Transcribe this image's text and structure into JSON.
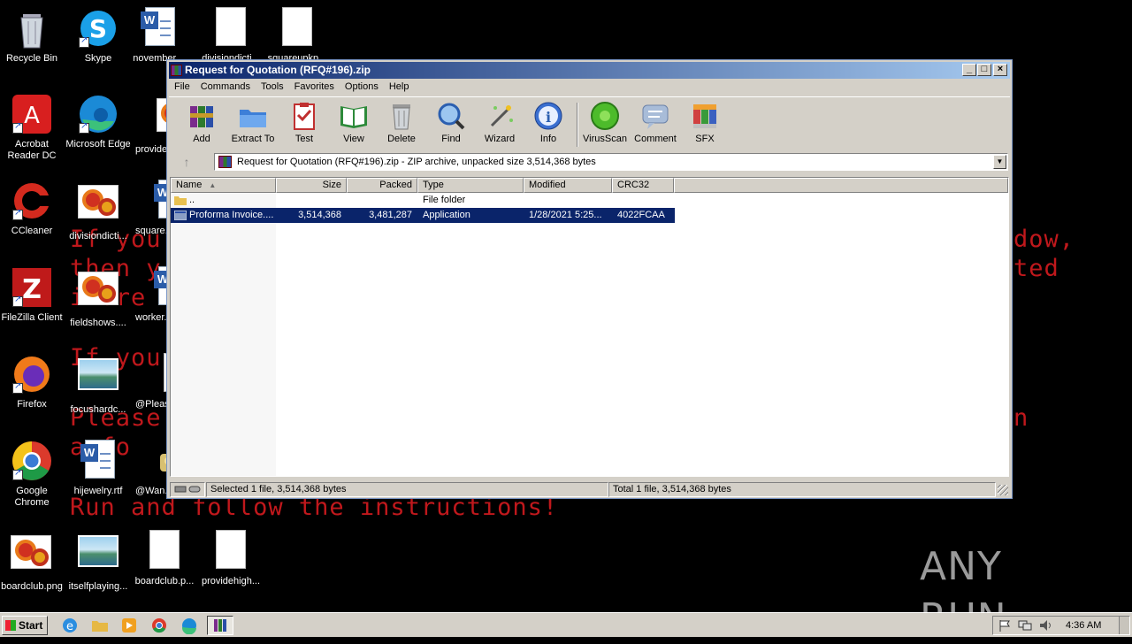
{
  "ransom_lines": [
    "If you",
    "then y",
    "i fre",
    "If you",
    "Please",
    "a fo",
    "Run and follow the instructions!",
    "dow,",
    "ted",
    "n"
  ],
  "desktop": {
    "icons": [
      {
        "label": "Recycle Bin"
      },
      {
        "label": "Skype"
      },
      {
        "label": "november..."
      },
      {
        "label": "divisiondicti..."
      },
      {
        "label": "squareupkp..."
      },
      {
        "label": "Acrobat Reader DC"
      },
      {
        "label": "Microsoft Edge"
      },
      {
        "label": "provide..."
      },
      {
        "label": "CCleaner"
      },
      {
        "label": "divisiondicti..."
      },
      {
        "label": "square..."
      },
      {
        "label": "FileZilla Client"
      },
      {
        "label": "fieldshows...."
      },
      {
        "label": "worker..."
      },
      {
        "label": "Firefox"
      },
      {
        "label": "focushardc..."
      },
      {
        "label": "@Pleas..."
      },
      {
        "label": "Google Chrome"
      },
      {
        "label": "hijewelry.rtf"
      },
      {
        "label": "@Wan..."
      },
      {
        "label": "boardclub.png"
      },
      {
        "label": "itselfplaying..."
      },
      {
        "label": "boardclub.p..."
      },
      {
        "label": "providehigh..."
      }
    ]
  },
  "window": {
    "title": "Request for Quotation (RFQ#196).zip",
    "menu": [
      "File",
      "Commands",
      "Tools",
      "Favorites",
      "Options",
      "Help"
    ],
    "toolbar": [
      "Add",
      "Extract To",
      "Test",
      "View",
      "Delete",
      "Find",
      "Wizard",
      "Info",
      "VirusScan",
      "Comment",
      "SFX"
    ],
    "address": "Request for Quotation (RFQ#196).zip - ZIP archive, unpacked size 3,514,368 bytes",
    "columns": [
      "Name",
      "Size",
      "Packed",
      "Type",
      "Modified",
      "CRC32"
    ],
    "rows": [
      {
        "name": "..",
        "size": "",
        "packed": "",
        "type": "File folder",
        "modified": "",
        "crc": ""
      },
      {
        "name": "Proforma Invoice....",
        "size": "3,514,368",
        "packed": "3,481,287",
        "type": "Application",
        "modified": "1/28/2021 5:25...",
        "crc": "4022FCAA"
      }
    ],
    "status_left": "Selected 1 file, 3,514,368 bytes",
    "status_right": "Total 1 file, 3,514,368 bytes"
  },
  "taskbar": {
    "start": "Start",
    "clock": "4:36 AM"
  },
  "watermark": "ANY RUN"
}
